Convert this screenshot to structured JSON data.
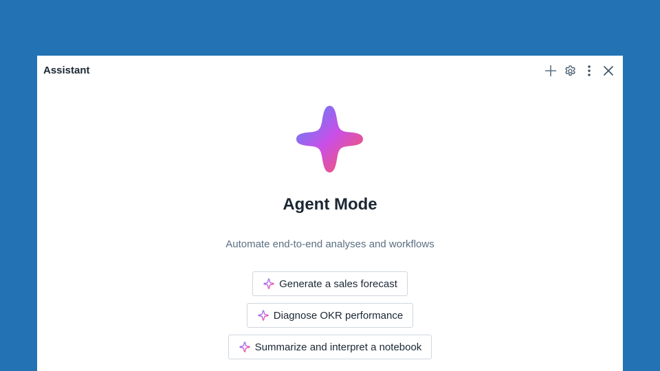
{
  "panel": {
    "title": "Assistant",
    "header_icons": [
      "plus-icon",
      "gear-icon",
      "kebab-menu-icon",
      "close-icon"
    ]
  },
  "hero": {
    "icon": "sparkle-star-icon",
    "heading": "Agent Mode",
    "subtitle": "Automate end-to-end analyses and workflows"
  },
  "suggestions": [
    {
      "label": "Generate a sales forecast",
      "icon": "sparkle-icon"
    },
    {
      "label": "Diagnose OKR performance",
      "icon": "sparkle-icon"
    },
    {
      "label": "Summarize and interpret a notebook",
      "icon": "sparkle-icon"
    }
  ],
  "colors": {
    "background": "#2272b4",
    "panel": "#ffffff",
    "gradient_start": "#4c8cf5",
    "gradient_mid": "#c94ee8",
    "gradient_end": "#ff5a4c"
  }
}
